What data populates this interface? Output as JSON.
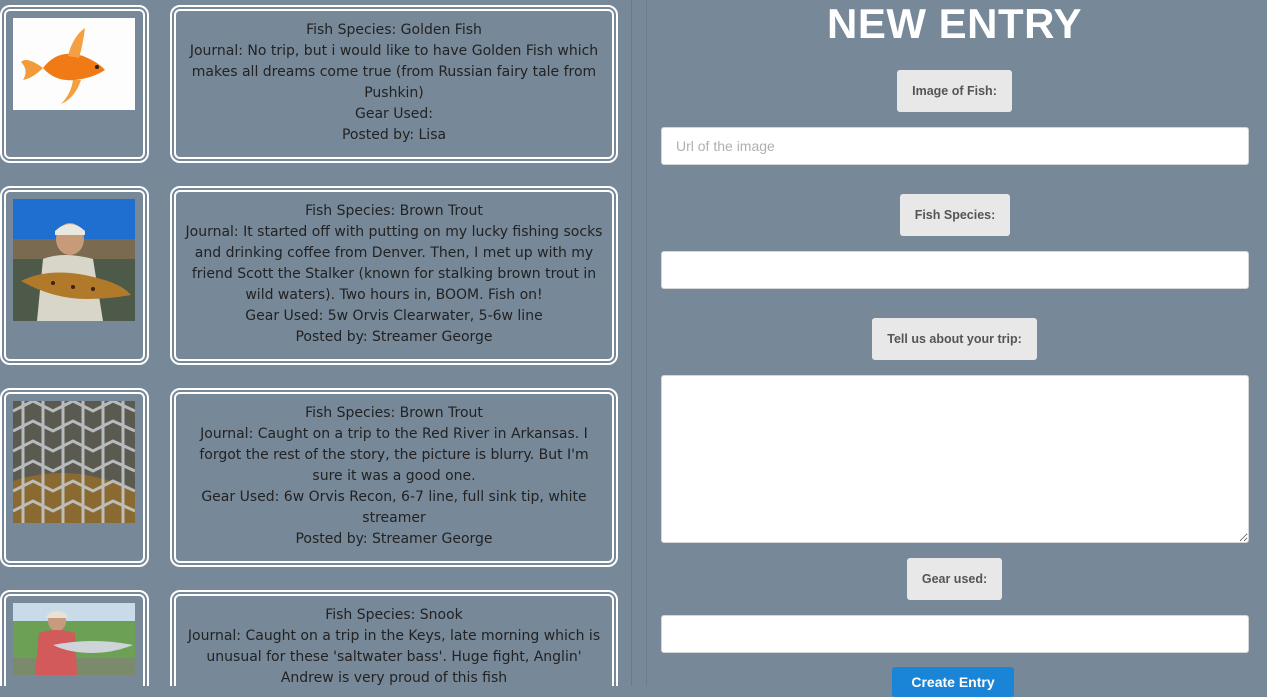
{
  "entries": [
    {
      "image_alt": "goldfish",
      "species": "Fish Species: Golden Fish",
      "journal": "Journal: No trip, but i would like to have Golden Fish which makes all dreams come true (from Russian fairy tale from Pushkin)",
      "gear": "Gear Used:",
      "posted": "Posted by: Lisa"
    },
    {
      "image_alt": "angler holding brown trout",
      "species": "Fish Species: Brown Trout",
      "journal": "Journal: It started off with putting on my lucky fishing socks and drinking coffee from Denver. Then, I met up with my friend Scott the Stalker (known for stalking brown trout in wild waters). Two hours in, BOOM. Fish on!",
      "gear": "Gear Used: 5w Orvis Clearwater, 5-6w line",
      "posted": "Posted by: Streamer George"
    },
    {
      "image_alt": "trout in landing net",
      "species": "Fish Species: Brown Trout",
      "journal": "Journal: Caught on a trip to the Red River in Arkansas. I forgot the rest of the story, the picture is blurry. But I'm sure it was a good one.",
      "gear": "Gear Used: 6w Orvis Recon, 6-7 line, full sink tip, white streamer",
      "posted": "Posted by: Streamer George"
    },
    {
      "image_alt": "angler holding snook",
      "species": "Fish Species: Snook",
      "journal": "Journal: Caught on a trip in the Keys, late morning which is unusual for these 'saltwater bass'. Huge fight, Anglin' Andrew is very proud of this fish",
      "gear": "",
      "posted": ""
    }
  ],
  "form": {
    "title": "NEW ENTRY",
    "image_label": "Image of Fish:",
    "image_placeholder": "Url of the image",
    "image_value": "",
    "species_label": "Fish Species:",
    "species_value": "",
    "trip_label": "Tell us about your trip:",
    "trip_value": "",
    "gear_label": "Gear used:",
    "gear_value": "",
    "submit_label": "Create Entry"
  },
  "colors": {
    "background": "#778899",
    "submit": "#1a84d6",
    "label_bg": "#e8e8e8"
  }
}
